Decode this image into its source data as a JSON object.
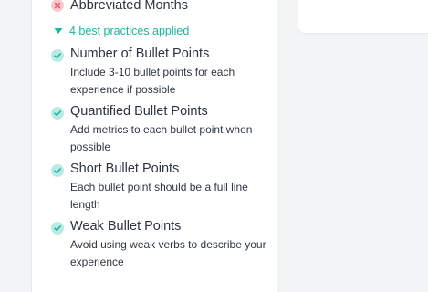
{
  "failed_item": {
    "title": "Abbreviated Months",
    "icon": "x-circle-icon",
    "color": "#e85d68"
  },
  "toggle": {
    "label": "4 best practices applied",
    "icon": "caret-down-icon",
    "color": "#1ab6a0"
  },
  "practices": [
    {
      "title": "Number of Bullet Points",
      "description": "Include 3-10 bullet points for each experience if possible",
      "icon": "check-circle-icon"
    },
    {
      "title": "Quantified Bullet Points",
      "description": "Add metrics to each bullet point when possible",
      "icon": "check-circle-icon"
    },
    {
      "title": "Short Bullet Points",
      "description": "Each bullet point should be a full line length",
      "icon": "check-circle-icon"
    },
    {
      "title": "Weak Bullet Points",
      "description": "Avoid using weak verbs to describe your experience",
      "icon": "check-circle-icon"
    }
  ],
  "colors": {
    "check": "#1ab6a0",
    "check_bg": "#b9ebe3",
    "x_bg": "#f9c9cf"
  }
}
